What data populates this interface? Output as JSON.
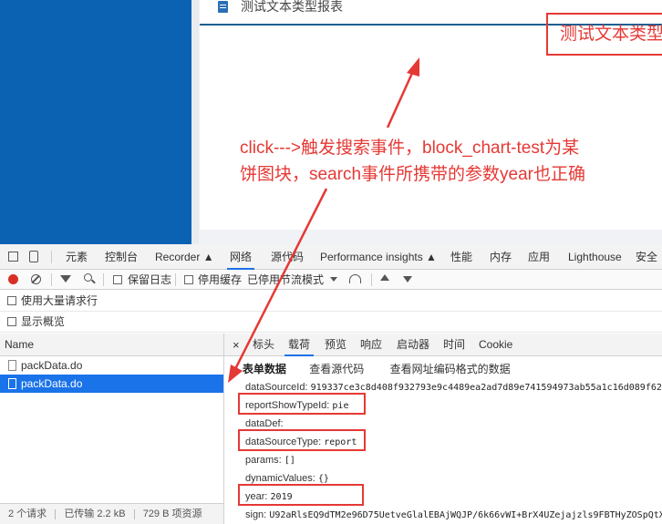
{
  "page": {
    "report_header_title": "测试文本类型报表",
    "report_title_highlight": "测试文本类型报表",
    "annotation_lines": [
      "click--->触发搜索事件，block_chart-test为某",
      "饼图块，search事件所携带的参数year也正确"
    ]
  },
  "devtools": {
    "tabs": [
      "元素",
      "控制台",
      "Recorder ▲",
      "网络",
      "源代码",
      "Performance insights ▲",
      "性能",
      "内存",
      "应用",
      "Lighthouse",
      "安全"
    ],
    "active_tab": "网络",
    "toolbar": {
      "preserve_log": "保留日志",
      "disable_cache": "停用缓存",
      "throttling": "已停用节流模式"
    },
    "options": {
      "large_rows": "使用大量请求行",
      "show_overview": "显示概览"
    },
    "request_list": {
      "header": "Name",
      "rows": [
        "packData.do",
        "packData.do"
      ],
      "selected_index": 1,
      "status": {
        "requests": "2 个请求",
        "transferred": "已传输 2.2 kB",
        "resources": "729 B 项资源"
      }
    },
    "detail": {
      "close": "×",
      "tabs": [
        "标头",
        "载荷",
        "预览",
        "响应",
        "启动器",
        "时间",
        "Cookie"
      ],
      "active_tab": "载荷",
      "section_title": "表单数据",
      "view_source": "查看源代码",
      "view_url_encoded": "查看网址编码格式的数据",
      "fields": [
        {
          "key": "dataSourceId:",
          "value": "919337ce3c8d408f932793e9c4489ea2ad7d89e741594973ab55a1c16d089f62"
        },
        {
          "key": "reportShowTypeId:",
          "value": "pie"
        },
        {
          "key": "dataDef:",
          "value": ""
        },
        {
          "key": "dataSourceType:",
          "value": "report"
        },
        {
          "key": "params:",
          "value": "[]"
        },
        {
          "key": "dynamicValues:",
          "value": "{}"
        },
        {
          "key": "year:",
          "value": "2019"
        },
        {
          "key": "sign:",
          "value": "U92aRlsEQ9dTM2e96D75UetveGlalEBAjWQJP/6k66vWI+BrX4UZejajzls9FBTHyZOSpQtX"
        }
      ]
    }
  },
  "colors": {
    "annotation_red": "#e53935",
    "nav_blue": "#0b62b3",
    "selection_blue": "#1a73e8"
  }
}
